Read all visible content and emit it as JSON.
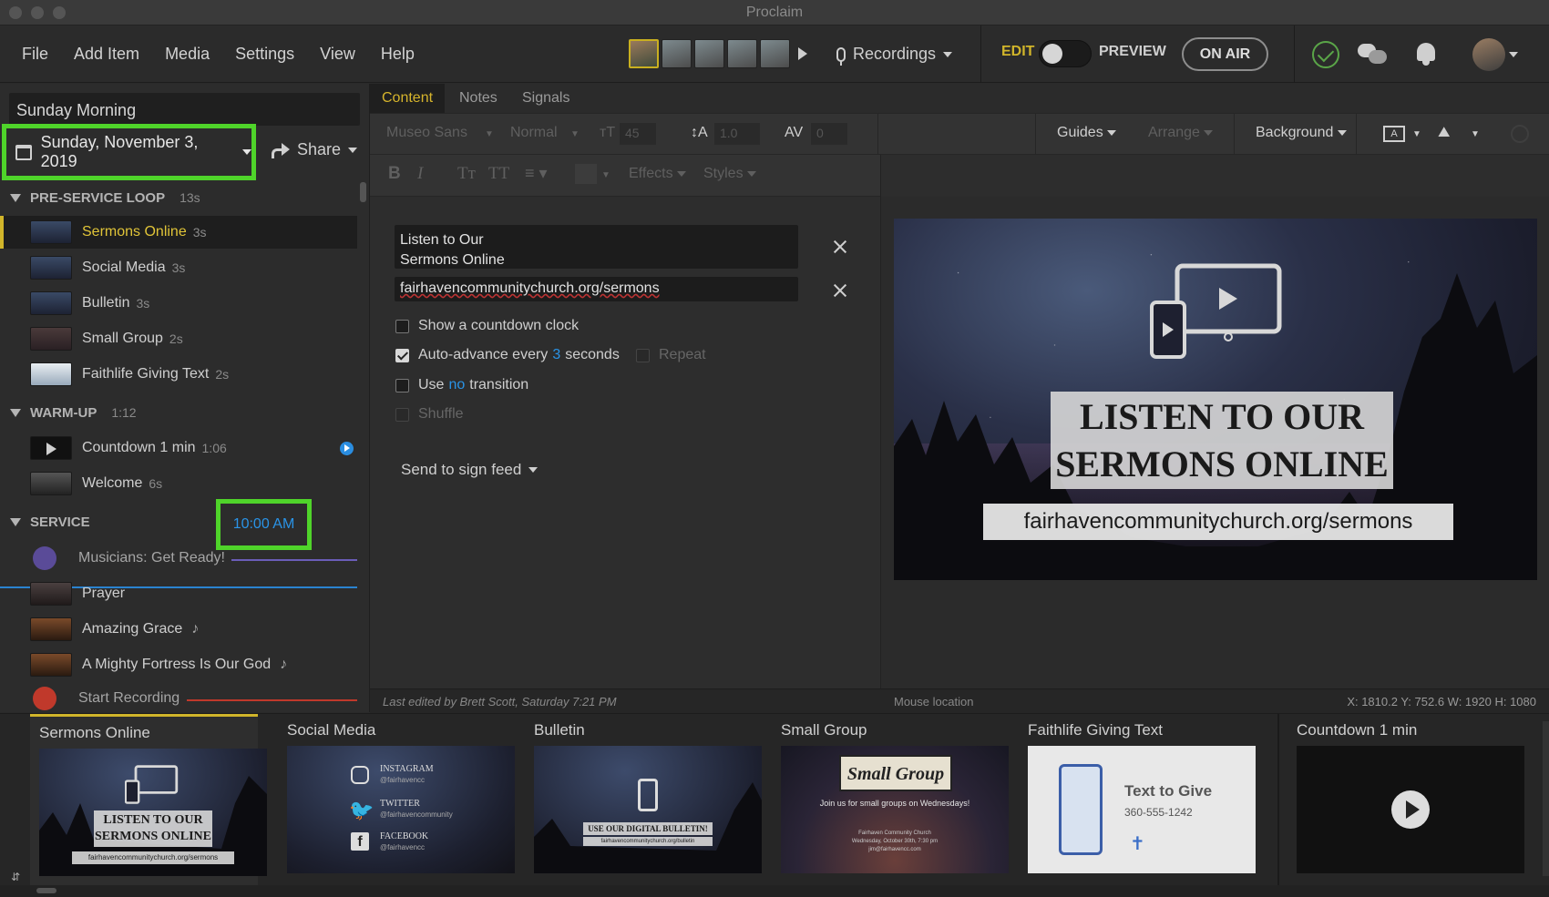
{
  "window": {
    "title": "Proclaim"
  },
  "menu": [
    "File",
    "Add Item",
    "Media",
    "Settings",
    "View",
    "Help"
  ],
  "toolbar": {
    "recordings_label": "Recordings",
    "edit_label": "EDIT",
    "preview_label": "PREVIEW",
    "on_air_label": "ON AIR"
  },
  "service": {
    "name": "Sunday Morning",
    "date": "Sunday, November 3, 2019",
    "share_label": "Share"
  },
  "sections": [
    {
      "name": "PRE-SERVICE LOOP",
      "duration": "13s",
      "items": [
        {
          "label": "Sermons Online",
          "duration": "3s"
        },
        {
          "label": "Social Media",
          "duration": "3s"
        },
        {
          "label": "Bulletin",
          "duration": "3s"
        },
        {
          "label": "Small Group",
          "duration": "2s"
        },
        {
          "label": "Faithlife Giving Text",
          "duration": "2s"
        }
      ]
    },
    {
      "name": "WARM-UP",
      "duration": "1:12",
      "items": [
        {
          "label": "Countdown 1 min",
          "duration": "1:06"
        },
        {
          "label": "Welcome",
          "duration": "6s"
        }
      ]
    },
    {
      "name": "SERVICE",
      "time": "10:00 AM",
      "items": [
        {
          "label": "Musicians: Get Ready!"
        },
        {
          "label": "Prayer"
        },
        {
          "label": "Amazing Grace",
          "note": "♪"
        },
        {
          "label": "A Mighty Fortress Is Our God",
          "note": "♪"
        },
        {
          "label": "Start Recording"
        }
      ]
    }
  ],
  "tabs": [
    "Content",
    "Notes",
    "Signals"
  ],
  "format": {
    "font": "Museo Sans",
    "weight": "Normal",
    "size": "45",
    "line_height": "1.0",
    "spacing": "0",
    "guides": "Guides",
    "arrange": "Arrange",
    "background": "Background",
    "effects": "Effects",
    "styles": "Styles",
    "bold": "B",
    "italic": "I",
    "tt1": "Tт",
    "tt2": "TT"
  },
  "editor": {
    "title_line1": "Listen to Our",
    "title_line2": "Sermons Online",
    "url": "fairhavencommunitychurch.org/sermons",
    "countdown_label": "Show a  countdown clock",
    "autoadvance_pre": "Auto-advance every",
    "autoadvance_value": "3",
    "autoadvance_post": "seconds",
    "repeat_label": "Repeat",
    "transition_pre": "Use",
    "transition_value": "no",
    "transition_post": "transition",
    "shuffle_label": "Shuffle",
    "send_sign_feed": "Send to sign feed"
  },
  "preview": {
    "title_line1": "LISTEN TO OUR",
    "title_line2": "SERMONS ONLINE",
    "url": "fairhavencommunitychurch.org/sermons"
  },
  "status": {
    "last_edited": "Last edited by Brett Scott, Saturday 7:21 PM",
    "mouse_location": "Mouse location",
    "coords": "X: 1810.2  Y: 752.6    W: 1920  H: 1080"
  },
  "strip": [
    {
      "label": "Sermons Online",
      "thumb_title1": "LISTEN TO OUR",
      "thumb_title2": "SERMONS ONLINE",
      "thumb_url": "fairhavencommunitychurch.org/sermons"
    },
    {
      "label": "Social Media",
      "instagram": "INSTAGRAM",
      "instagram_handle": "@fairhavencc",
      "twitter": "TWITTER",
      "twitter_handle": "@fairhavencommunity",
      "facebook": "FACEBOOK",
      "facebook_handle": "@fairhavencc"
    },
    {
      "label": "Bulletin",
      "thumb_title": "USE OUR DIGITAL BULLETIN!",
      "thumb_url": "fairhavencommunitychurch.org/bulletin"
    },
    {
      "label": "Small Group",
      "thumb_title": "Small Group",
      "thumb_sub": "Join us for small groups on Wednesdays!",
      "thumb_line1": "Fairhaven Community Church",
      "thumb_line2": "Wednesday, October 30th, 7:30 pm",
      "thumb_line3": "jim@fairhavencc.com"
    },
    {
      "label": "Faithlife Giving Text",
      "thumb_title": "Text to Give",
      "thumb_phone": "360-555-1242"
    },
    {
      "label": "Countdown 1 min"
    }
  ]
}
